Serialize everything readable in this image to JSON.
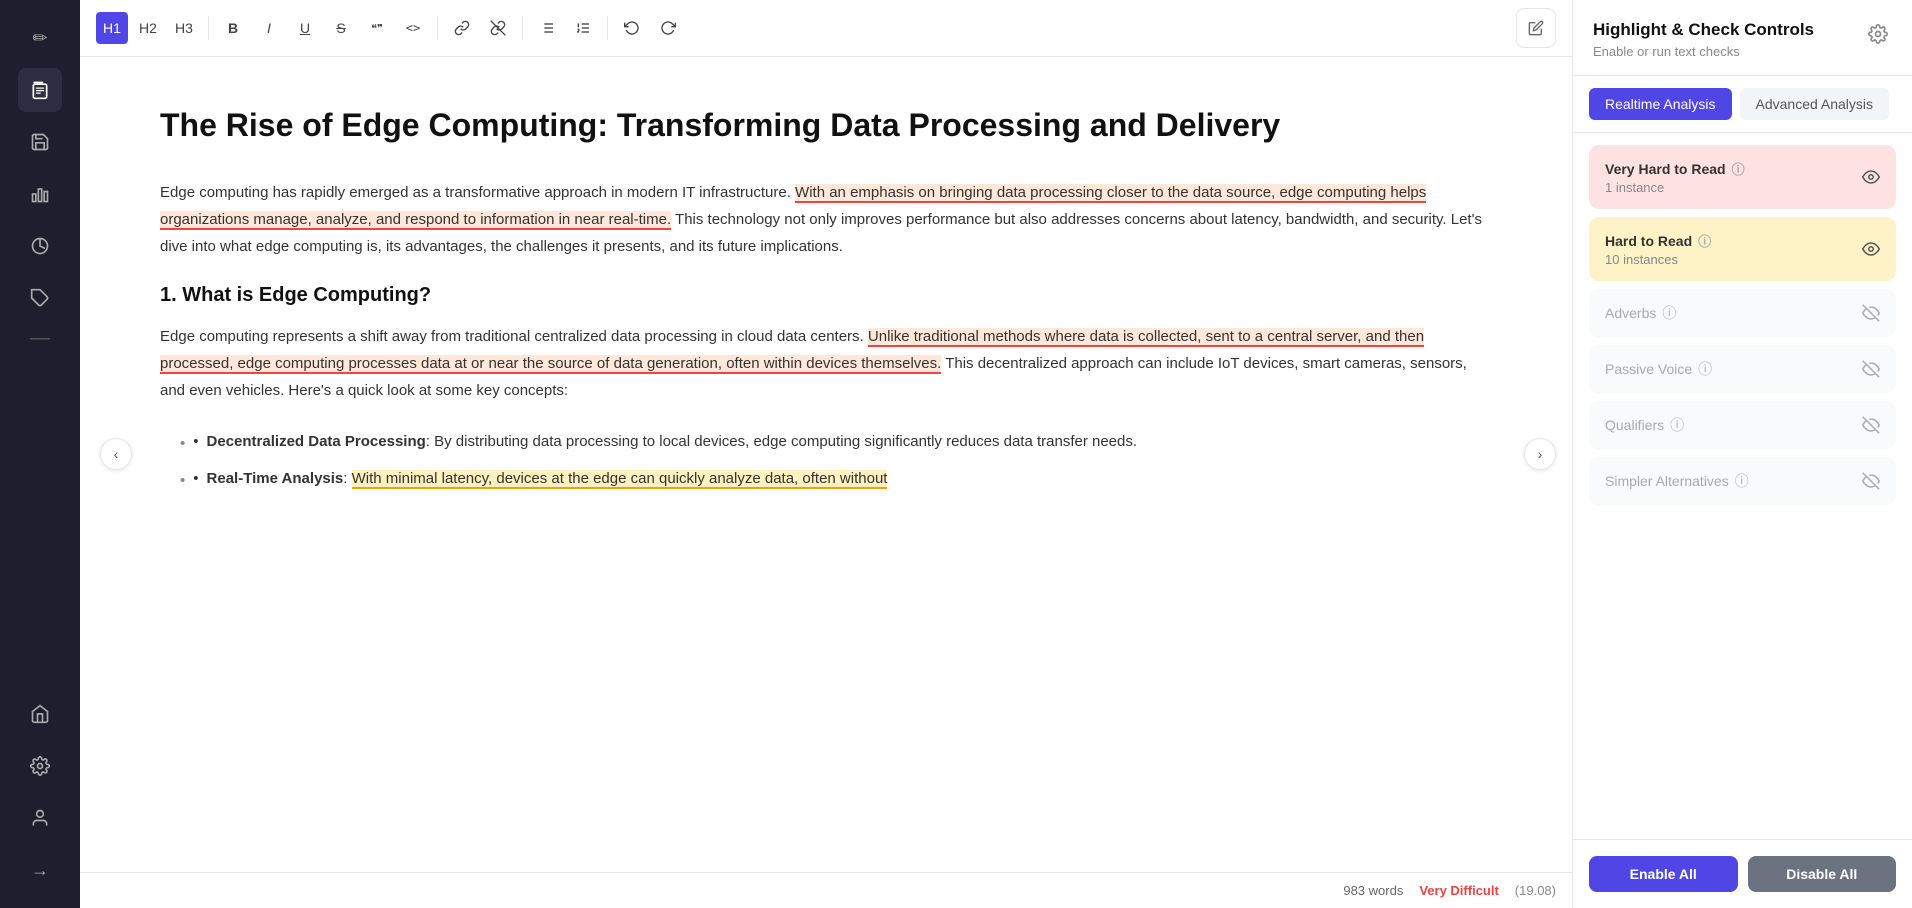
{
  "sidebar": {
    "icons": [
      {
        "name": "edit-icon",
        "symbol": "✏",
        "active": false
      },
      {
        "name": "document-icon",
        "symbol": "📄",
        "active": true
      },
      {
        "name": "save-icon",
        "symbol": "💾",
        "active": false
      },
      {
        "name": "chart-icon",
        "symbol": "📊",
        "active": false
      },
      {
        "name": "analytics-icon",
        "symbol": "🔄",
        "active": false
      },
      {
        "name": "tag-icon",
        "symbol": "🏷",
        "active": false
      },
      {
        "name": "separator-icon",
        "symbol": "|",
        "active": false
      },
      {
        "name": "home-icon",
        "symbol": "⌂",
        "active": false
      },
      {
        "name": "settings-icon",
        "symbol": "⚙",
        "active": false
      },
      {
        "name": "user-icon",
        "symbol": "👤",
        "active": false
      },
      {
        "name": "arrow-icon",
        "symbol": "→",
        "active": false
      }
    ]
  },
  "toolbar": {
    "buttons": [
      {
        "name": "h1-button",
        "label": "H1",
        "active": true
      },
      {
        "name": "h2-button",
        "label": "H2",
        "active": false
      },
      {
        "name": "h3-button",
        "label": "H3",
        "active": false
      },
      {
        "name": "bold-button",
        "label": "B",
        "active": false
      },
      {
        "name": "italic-button",
        "label": "I",
        "active": false
      },
      {
        "name": "underline-button",
        "label": "U",
        "active": false
      },
      {
        "name": "strikethrough-button",
        "label": "S",
        "active": false
      },
      {
        "name": "quote-button",
        "label": "❝❞",
        "active": false
      },
      {
        "name": "code-button",
        "label": "<>",
        "active": false
      },
      {
        "name": "link-button",
        "label": "🔗",
        "active": false
      },
      {
        "name": "unlink-button",
        "label": "⛓",
        "active": false
      },
      {
        "name": "list-button",
        "label": "≡",
        "active": false
      },
      {
        "name": "ordered-list-button",
        "label": "1≡",
        "active": false
      },
      {
        "name": "undo-button",
        "label": "↺",
        "active": false
      },
      {
        "name": "redo-button",
        "label": "↻",
        "active": false
      }
    ],
    "edit_icon": "✏"
  },
  "document": {
    "title": "The Rise of Edge Computing: Transforming Data Processing and Delivery",
    "paragraphs": [
      {
        "id": "para1",
        "parts": [
          {
            "text": "Edge computing has rapidly emerged as a transformative approach in modern IT infrastructure. ",
            "highlight": "none"
          },
          {
            "text": "With an emphasis on bringing data processing closer to the data source, edge computing helps organizations manage, analyze, and respond to information in near real-time.",
            "highlight": "orange"
          },
          {
            "text": " This technology not only improves performance but also addresses concerns about latency, bandwidth, and security. Let's dive into what edge computing is, its advantages, the challenges it presents, and its future implications.",
            "highlight": "none"
          }
        ]
      },
      {
        "id": "section1",
        "type": "heading",
        "text": "1. What is Edge Computing?"
      },
      {
        "id": "para2",
        "parts": [
          {
            "text": "Edge computing represents a shift away from traditional centralized data processing in cloud data centers. ",
            "highlight": "none"
          },
          {
            "text": "Unlike traditional methods where data is collected, sent to a central server, and then processed, edge computing processes data at or near the source of data generation, often within devices themselves.",
            "highlight": "orange"
          },
          {
            "text": " This decentralized approach can include IoT devices, smart cameras, sensors, and even vehicles. Here's a quick look at some key concepts:",
            "highlight": "none"
          }
        ]
      }
    ],
    "list_items": [
      {
        "bold": "Decentralized Data Processing",
        "text": ": By distributing data processing to local devices, edge computing significantly reduces data transfer needs."
      },
      {
        "bold": "Real-Time Analysis",
        "text": ": With minimal latency, devices at the edge can quickly analyze data, often without"
      }
    ],
    "word_count": "983 words",
    "difficulty_label": "Very Difficult",
    "difficulty_score": "(19.08)"
  },
  "right_panel": {
    "title": "Highlight & Check Controls",
    "subtitle": "Enable or run text checks",
    "settings_icon": "⚙",
    "tabs": [
      {
        "name": "tab-realtime",
        "label": "Realtime Analysis",
        "active": true
      },
      {
        "name": "tab-advanced",
        "label": "Advanced Analysis",
        "active": false
      }
    ],
    "checks": [
      {
        "name": "very-hard-to-read",
        "label": "Very Hard to Read",
        "info": true,
        "count": "1 instance",
        "state": "active-red",
        "eye_visible": true
      },
      {
        "name": "hard-to-read",
        "label": "Hard to Read",
        "info": true,
        "count": "10 instances",
        "state": "active-orange",
        "eye_visible": true
      },
      {
        "name": "adverbs",
        "label": "Adverbs",
        "info": true,
        "count": null,
        "state": "inactive",
        "eye_visible": false
      },
      {
        "name": "passive-voice",
        "label": "Passive Voice",
        "info": true,
        "count": null,
        "state": "inactive",
        "eye_visible": false
      },
      {
        "name": "qualifiers",
        "label": "Qualifiers",
        "info": true,
        "count": null,
        "state": "inactive",
        "eye_visible": false
      },
      {
        "name": "simpler-alternatives",
        "label": "Simpler Alternatives",
        "info": true,
        "count": null,
        "state": "inactive",
        "eye_visible": false
      }
    ],
    "footer": {
      "enable_all": "Enable All",
      "disable_all": "Disable All"
    }
  }
}
